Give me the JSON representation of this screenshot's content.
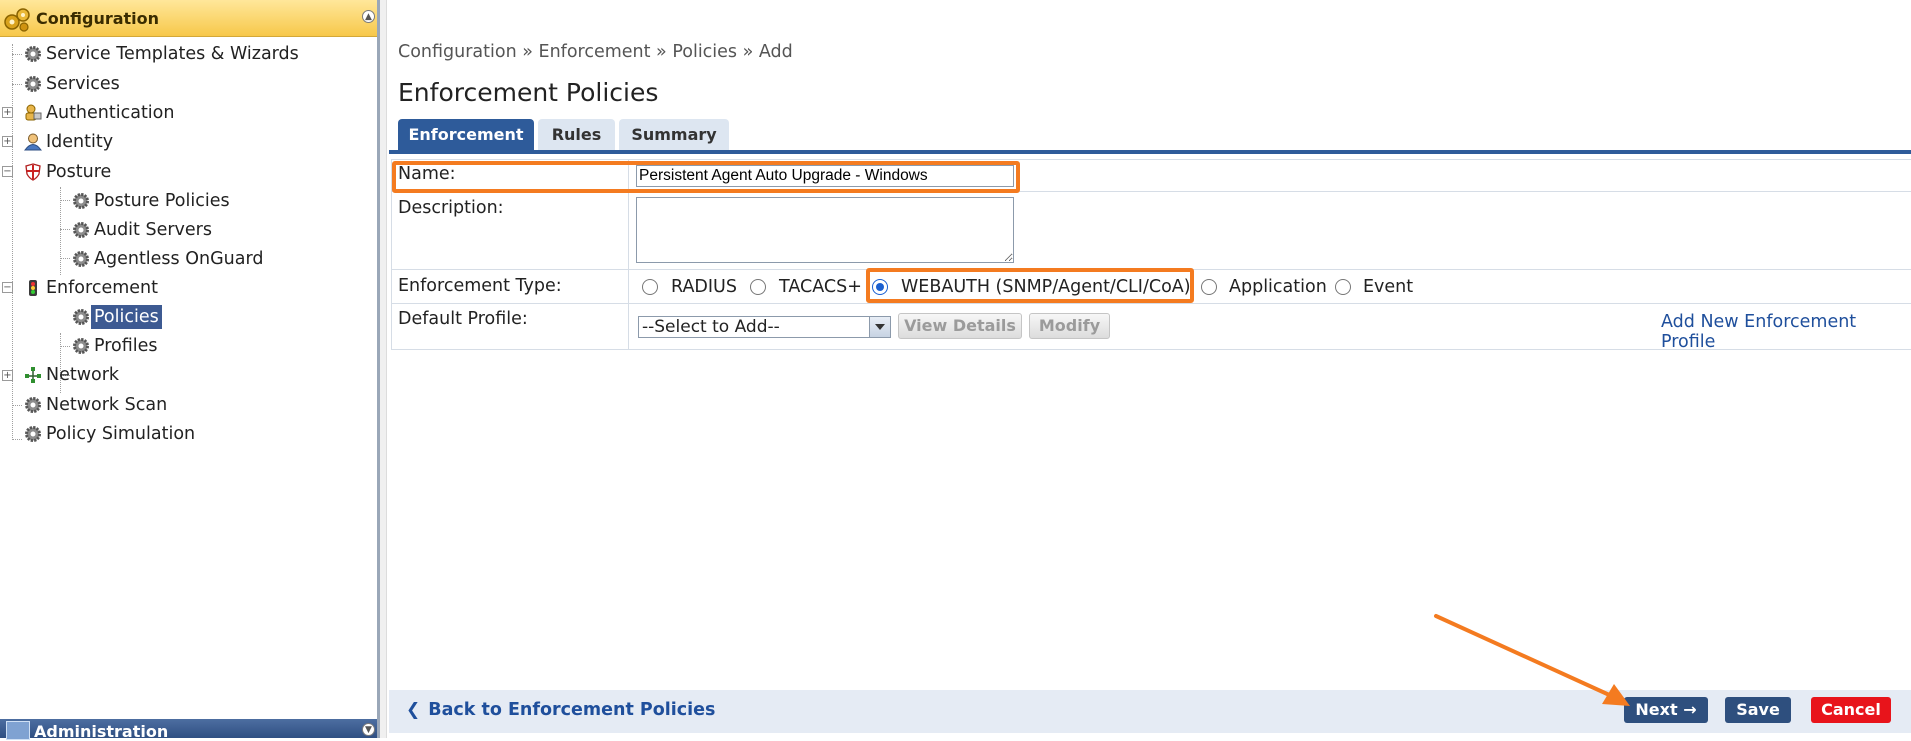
{
  "sidebar": {
    "header": "Configuration",
    "footer_header": "Administration",
    "items": [
      {
        "label": "Service Templates & Wizards"
      },
      {
        "label": "Services"
      },
      {
        "label": "Authentication"
      },
      {
        "label": "Identity"
      },
      {
        "label": "Posture"
      },
      {
        "label": "Posture Policies"
      },
      {
        "label": "Audit Servers"
      },
      {
        "label": "Agentless OnGuard"
      },
      {
        "label": "Enforcement"
      },
      {
        "label": "Policies",
        "selected": true
      },
      {
        "label": "Profiles"
      },
      {
        "label": "Network"
      },
      {
        "label": "Network Scan"
      },
      {
        "label": "Policy Simulation"
      }
    ]
  },
  "breadcrumb": "Configuration » Enforcement » Policies » Add",
  "page_title": "Enforcement Policies",
  "tabs": [
    {
      "label": "Enforcement",
      "active": true
    },
    {
      "label": "Rules",
      "active": false
    },
    {
      "label": "Summary",
      "active": false
    }
  ],
  "form": {
    "name_label": "Name:",
    "name_value": "Persistent Agent Auto Upgrade - Windows",
    "description_label": "Description:",
    "description_value": "",
    "enforcement_type_label": "Enforcement Type:",
    "enforcement_types": [
      {
        "label": "RADIUS",
        "selected": false
      },
      {
        "label": "TACACS+",
        "selected": false
      },
      {
        "label": "WEBAUTH (SNMP/Agent/CLI/CoA)",
        "selected": true
      },
      {
        "label": "Application",
        "selected": false
      },
      {
        "label": "Event",
        "selected": false
      }
    ],
    "default_profile_label": "Default Profile:",
    "default_profile_value": "--Select to Add--",
    "view_details_label": "View Details",
    "modify_label": "Modify",
    "add_profile_link": "Add New Enforcement Profile"
  },
  "footer": {
    "back_link": "Back to Enforcement Policies",
    "next_label": "Next →",
    "save_label": "Save",
    "cancel_label": "Cancel"
  },
  "colors": {
    "highlight": "#f47b20",
    "primary_blue": "#2e5b9a",
    "cancel_red": "#e8141b",
    "link_blue": "#1f4f9c"
  }
}
